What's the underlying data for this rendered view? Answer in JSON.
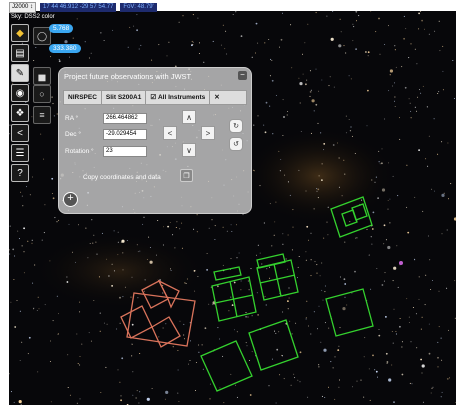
{
  "topbar": {
    "frame": "J2000 ↕",
    "coordinates": "17 44 46.912 -29 57 54.77",
    "fov": "FoV: 48.79'"
  },
  "survey": "Sky: DSS2 color",
  "bubbles": [
    "5.768",
    "333.380"
  ],
  "panel": {
    "title": "Project future observations with JWST",
    "instrument": "NIRSPEC",
    "mode": "Slit S200A1",
    "all_instruments": "All Instruments",
    "ra_label": "RA °",
    "ra_value": "266.464862",
    "dec_label": "Dec °",
    "dec_value": "-29.029454",
    "rotation_label": "Rotation °",
    "rotation_value": "23",
    "copy_label": "Copy coordinates and data"
  },
  "colors": {
    "footprint_green": "#34d12e",
    "footprint_selected": "#d9735b",
    "panel_bg": "#d2d2d2",
    "bubble": "#3aa6f0"
  },
  "icons": [
    "layers-icon",
    "catalog-icon",
    "pencil-icon",
    "camera-icon",
    "cube-icon",
    "share-icon",
    "menu-icon",
    "help-icon",
    "ellipse-icon",
    "chart-icon",
    "clear-icon",
    "list-icon"
  ]
}
